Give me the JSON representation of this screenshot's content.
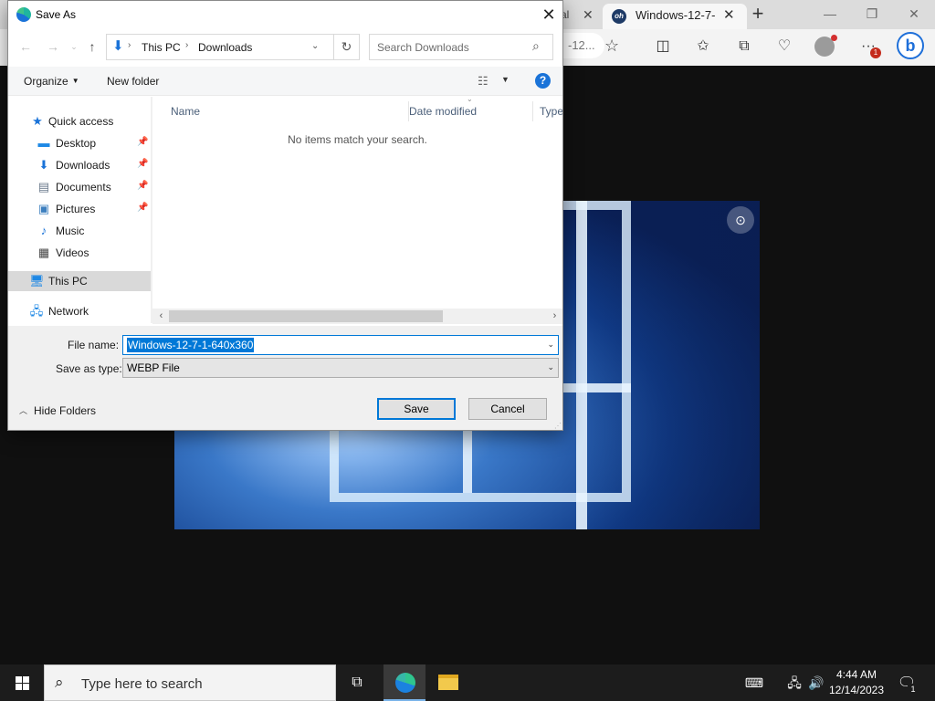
{
  "browser": {
    "partial_tab_title": "al",
    "active_tab_title": "Windows-12-7-",
    "active_tab_favicon": "oh",
    "address_partial": "-12...",
    "bing_label": "b",
    "notification_count": "1"
  },
  "dialog": {
    "title": "Save As",
    "breadcrumb": [
      "This PC",
      "Downloads"
    ],
    "search_placeholder": "Search Downloads",
    "commands": {
      "organize": "Organize",
      "new_folder": "New folder"
    },
    "help_label": "?",
    "nav_items": [
      {
        "label": "Quick access",
        "icon": "star-icon"
      },
      {
        "label": "Desktop",
        "icon": "desktop-icon",
        "pinned": true
      },
      {
        "label": "Downloads",
        "icon": "download-icon",
        "pinned": true
      },
      {
        "label": "Documents",
        "icon": "document-icon",
        "pinned": true
      },
      {
        "label": "Pictures",
        "icon": "pictures-icon",
        "pinned": true
      },
      {
        "label": "Music",
        "icon": "music-icon"
      },
      {
        "label": "Videos",
        "icon": "videos-icon"
      },
      {
        "label": "This PC",
        "icon": "computer-icon",
        "selected": true
      },
      {
        "label": "Network",
        "icon": "network-icon"
      }
    ],
    "columns": [
      "Name",
      "Date modified",
      "Type"
    ],
    "empty_message": "No items match your search.",
    "file_name_label": "File name:",
    "file_name_value": "Windows-12-7-1-640x360",
    "save_as_type_label": "Save as type:",
    "save_as_type_value": "WEBP File",
    "hide_folders_label": "Hide Folders",
    "save_label": "Save",
    "cancel_label": "Cancel"
  },
  "taskbar": {
    "search_placeholder": "Type here to search",
    "time": "4:44 AM",
    "date": "12/14/2023",
    "notification_count": "1"
  },
  "colors": {
    "accent": "#0078d7",
    "taskbar": "#1c1c1c",
    "desktop_bg": "#101010",
    "dialog_bg": "#ffffff",
    "selection": "#d9d9d9"
  }
}
